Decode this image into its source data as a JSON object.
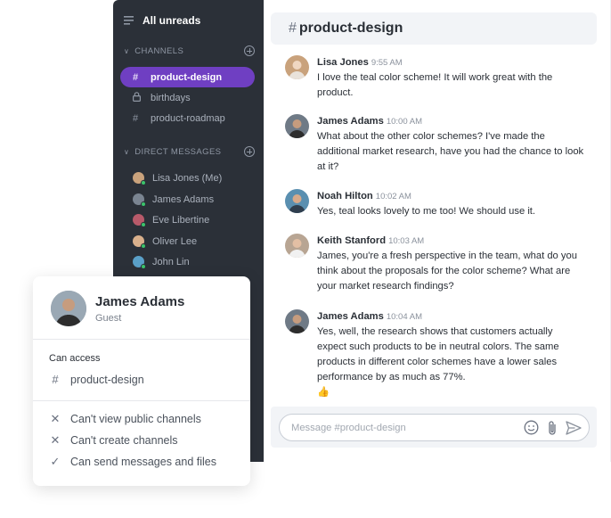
{
  "sidebar": {
    "all_unreads": "All unreads",
    "channels_heading": "CHANNELS",
    "channels": [
      {
        "label": "product-design",
        "icon": "hash-icon",
        "active": true
      },
      {
        "label": "birthdays",
        "icon": "lock-icon",
        "active": false
      },
      {
        "label": "product-roadmap",
        "icon": "hash-icon",
        "active": false
      }
    ],
    "dm_heading": "DIRECT MESSAGES",
    "direct_messages": [
      {
        "label": "Lisa Jones (Me)",
        "avatar_color": "#c9a27c"
      },
      {
        "label": "James Adams",
        "avatar_color": "#7a8491"
      },
      {
        "label": "Eve Libertine",
        "avatar_color": "#b85a6a"
      },
      {
        "label": "Oliver Lee",
        "avatar_color": "#d9b08c"
      },
      {
        "label": "John Lin",
        "avatar_color": "#5aa0c8"
      }
    ]
  },
  "channel": {
    "hash": "#",
    "name": "product-design"
  },
  "messages": [
    {
      "name": "Lisa Jones",
      "time": "9:55 AM",
      "lines": [
        "I love the teal color scheme! It will work great with the",
        "product."
      ],
      "avatar_color": "#c9a27c"
    },
    {
      "name": "James Adams",
      "time": "10:00 AM",
      "lines": [
        "What about the other color schemes? I've made the",
        "additional market research, have you had the chance to look",
        "at it?"
      ],
      "avatar_color": "#6f7a86"
    },
    {
      "name": "Noah Hilton",
      "time": "10:02 AM",
      "lines": [
        "Yes, teal looks lovely to me too! We should use it."
      ],
      "avatar_color": "#5a8fb0"
    },
    {
      "name": "Keith Stanford",
      "time": "10:03 AM",
      "lines": [
        "James, you're a fresh perspective in the team, what do you",
        "think about the proposals for the color scheme? What are",
        "your market research findings?"
      ],
      "avatar_color": "#b8a593"
    },
    {
      "name": "James Adams",
      "time": "10:04 AM",
      "lines": [
        "Yes, well, the research shows that customers actually",
        "expect such products to be in neutral colors. The same",
        "products in different color schemes have a lower sales",
        "performance by as much as 77%.",
        "👍"
      ],
      "avatar_color": "#6f7a86"
    }
  ],
  "composer": {
    "placeholder": "Message #product-design"
  },
  "guest_card": {
    "name": "James Adams",
    "role": "Guest",
    "can_access_label": "Can access",
    "access_channel": "product-design",
    "permissions": [
      {
        "label": "Can't view public channels",
        "icon": "x-icon",
        "glyph": "✕"
      },
      {
        "label": "Can't create channels",
        "icon": "x-icon",
        "glyph": "✕"
      },
      {
        "label": "Can send messages and files",
        "icon": "check-icon",
        "glyph": "✓"
      }
    ]
  }
}
